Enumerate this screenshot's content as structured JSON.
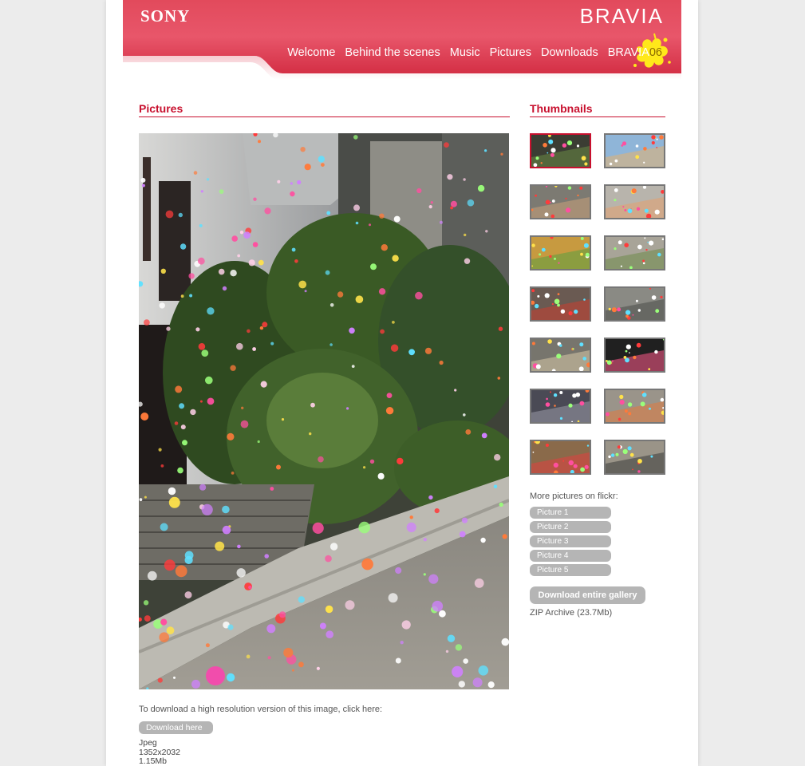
{
  "header": {
    "logo_sony": "SONY",
    "logo_bravia": "BRAVIA",
    "nav": [
      "Welcome",
      "Behind the scenes",
      "Music",
      "Pictures",
      "Downloads",
      "BRAVIA"
    ],
    "badge": "06",
    "brand_color": "#d9344a"
  },
  "main": {
    "title": "Pictures",
    "download_prompt": "To download a high resolution version of this image, click here:",
    "download_button": "Download here",
    "file": {
      "format": "Jpeg",
      "dimensions": "1352x2032",
      "size": "1.15Mb"
    }
  },
  "sidebar": {
    "title": "Thumbnails",
    "thumbnail_count": 14,
    "flickr_label": "More pictures on flickr:",
    "flickr_links": [
      "Picture 1",
      "Picture 2",
      "Picture 3",
      "Picture 4",
      "Picture 5"
    ],
    "gallery_button": "Download entire gallery",
    "gallery_info": "ZIP Archive (23.7Mb)"
  }
}
